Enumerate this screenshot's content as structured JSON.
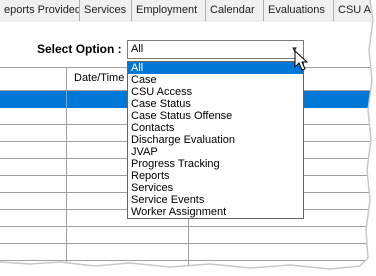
{
  "tabs": [
    {
      "label": "eports Provided",
      "selected": false
    },
    {
      "label": "Services",
      "selected": false
    },
    {
      "label": "Employment",
      "selected": false
    },
    {
      "label": "Calendar",
      "selected": false
    },
    {
      "label": "Evaluations",
      "selected": false
    },
    {
      "label": "CSU A",
      "selected": false
    }
  ],
  "filter": {
    "label": "Select Option :",
    "value": "All"
  },
  "grid": {
    "columns": [
      "Date/Time"
    ]
  },
  "dropdown": {
    "options": [
      "All",
      "Case",
      "CSU Access",
      "Case Status",
      "Case Status Offense",
      "Contacts",
      "Discharge Evaluation",
      "JVAP",
      "Progress Tracking",
      "Reports",
      "Services",
      "Service Events",
      "Worker Assignment"
    ],
    "selected_index": 0
  },
  "colors": {
    "highlight": "#0078d7",
    "grid_line": "#a0a0a0",
    "tab_bg": "#f0f0f0"
  }
}
